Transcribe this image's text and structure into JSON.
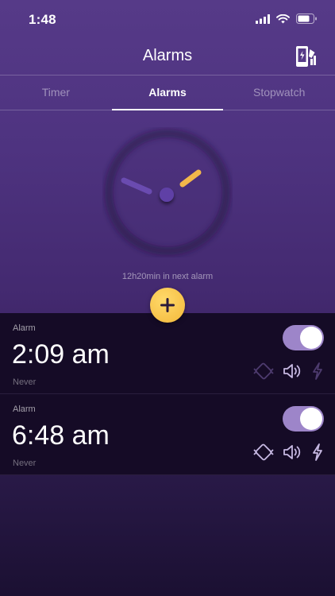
{
  "status_bar": {
    "time": "1:48"
  },
  "header": {
    "title": "Alarms"
  },
  "tabs": [
    {
      "label": "Timer",
      "active": false
    },
    {
      "label": "Alarms",
      "active": true
    },
    {
      "label": "Stopwatch",
      "active": false
    }
  ],
  "clock": {
    "hour_hand_color": "#6a4bb0",
    "minute_hand_color": "#f3b84a"
  },
  "next_alarm_text": "12h20min in next alarm",
  "alarms": [
    {
      "label": "Alarm",
      "time": "2:09 am",
      "repeat": "Never",
      "enabled": true,
      "vibrate_active": false,
      "sound_active": true,
      "flash_active": false
    },
    {
      "label": "Alarm",
      "time": "6:48 am",
      "repeat": "Never",
      "enabled": true,
      "vibrate_active": true,
      "sound_active": true,
      "flash_active": true
    }
  ],
  "colors": {
    "accent_yellow": "#f3b83a",
    "toggle_on": "#9d85c9",
    "row_bg": "#150b26"
  }
}
